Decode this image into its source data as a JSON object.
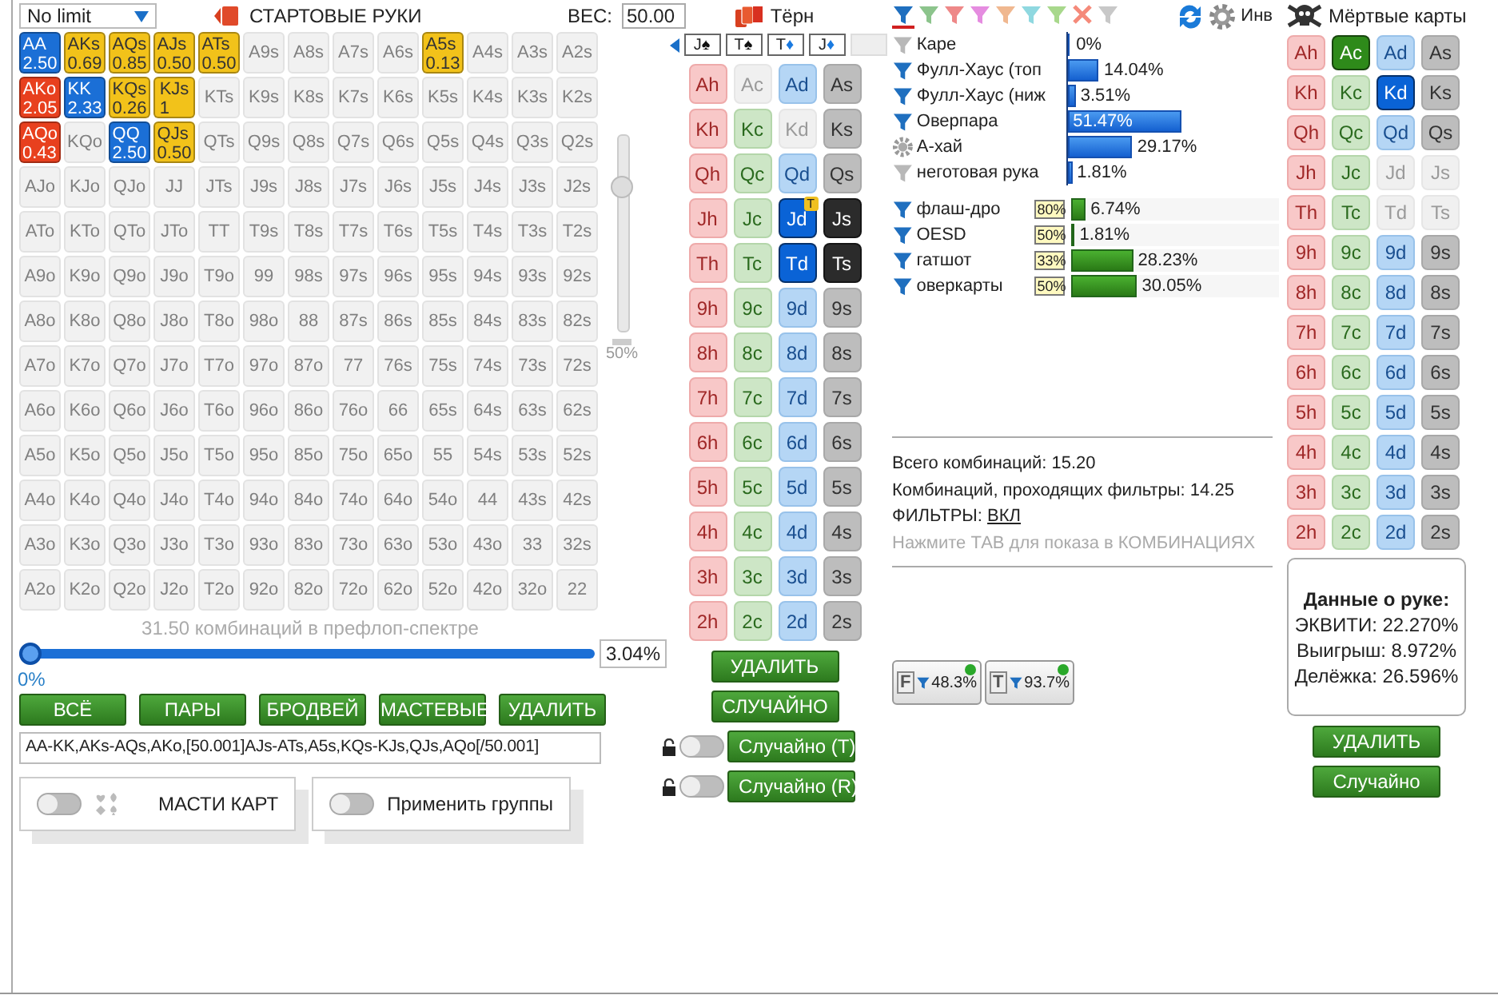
{
  "range_panel": {
    "game_select": {
      "value": "No limit"
    },
    "title": "СТАРТОВЫЕ РУКИ",
    "weight": {
      "label": "ВЕС:",
      "value": "50.00"
    },
    "grid": [
      [
        {
          "hand": "AA",
          "weight": "2.50",
          "color": "#1b6fd6"
        },
        {
          "hand": "AKs",
          "weight": "0.69",
          "color": "#f2c21a"
        },
        {
          "hand": "AQs",
          "weight": "0.85",
          "color": "#f2c21a"
        },
        {
          "hand": "AJs",
          "weight": "0.50",
          "color": "#f2c21a"
        },
        {
          "hand": "ATs",
          "weight": "0.50",
          "color": "#f2c21a"
        },
        {
          "hand": "A9s"
        },
        {
          "hand": "A8s"
        },
        {
          "hand": "A7s"
        },
        {
          "hand": "A6s"
        },
        {
          "hand": "A5s",
          "weight": "0.13",
          "color": "#f2c21a"
        },
        {
          "hand": "A4s"
        },
        {
          "hand": "A3s"
        },
        {
          "hand": "A2s"
        }
      ],
      [
        {
          "hand": "AKo",
          "weight": "2.05",
          "color": "#e8401e"
        },
        {
          "hand": "KK",
          "weight": "2.33",
          "color": "#1b6fd6"
        },
        {
          "hand": "KQs",
          "weight": "0.26",
          "color": "#f2c21a"
        },
        {
          "hand": "KJs",
          "weight": "1",
          "color": "#f2c21a"
        },
        {
          "hand": "KTs"
        },
        {
          "hand": "K9s"
        },
        {
          "hand": "K8s"
        },
        {
          "hand": "K7s"
        },
        {
          "hand": "K6s"
        },
        {
          "hand": "K5s"
        },
        {
          "hand": "K4s"
        },
        {
          "hand": "K3s"
        },
        {
          "hand": "K2s"
        }
      ],
      [
        {
          "hand": "AQo",
          "weight": "0.43",
          "color": "#e8401e"
        },
        {
          "hand": "KQo"
        },
        {
          "hand": "QQ",
          "weight": "2.50",
          "color": "#1b6fd6"
        },
        {
          "hand": "QJs",
          "weight": "0.50",
          "color": "#f2c21a"
        },
        {
          "hand": "QTs"
        },
        {
          "hand": "Q9s"
        },
        {
          "hand": "Q8s"
        },
        {
          "hand": "Q7s"
        },
        {
          "hand": "Q6s"
        },
        {
          "hand": "Q5s"
        },
        {
          "hand": "Q4s"
        },
        {
          "hand": "Q3s"
        },
        {
          "hand": "Q2s"
        }
      ],
      [
        {
          "hand": "AJo"
        },
        {
          "hand": "KJo"
        },
        {
          "hand": "QJo"
        },
        {
          "hand": "JJ"
        },
        {
          "hand": "JTs"
        },
        {
          "hand": "J9s"
        },
        {
          "hand": "J8s"
        },
        {
          "hand": "J7s"
        },
        {
          "hand": "J6s"
        },
        {
          "hand": "J5s"
        },
        {
          "hand": "J4s"
        },
        {
          "hand": "J3s"
        },
        {
          "hand": "J2s"
        }
      ],
      [
        {
          "hand": "ATo"
        },
        {
          "hand": "KTo"
        },
        {
          "hand": "QTo"
        },
        {
          "hand": "JTo"
        },
        {
          "hand": "TT"
        },
        {
          "hand": "T9s"
        },
        {
          "hand": "T8s"
        },
        {
          "hand": "T7s"
        },
        {
          "hand": "T6s"
        },
        {
          "hand": "T5s"
        },
        {
          "hand": "T4s"
        },
        {
          "hand": "T3s"
        },
        {
          "hand": "T2s"
        }
      ],
      [
        {
          "hand": "A9o"
        },
        {
          "hand": "K9o"
        },
        {
          "hand": "Q9o"
        },
        {
          "hand": "J9o"
        },
        {
          "hand": "T9o"
        },
        {
          "hand": "99"
        },
        {
          "hand": "98s"
        },
        {
          "hand": "97s"
        },
        {
          "hand": "96s"
        },
        {
          "hand": "95s"
        },
        {
          "hand": "94s"
        },
        {
          "hand": "93s"
        },
        {
          "hand": "92s"
        }
      ],
      [
        {
          "hand": "A8o"
        },
        {
          "hand": "K8o"
        },
        {
          "hand": "Q8o"
        },
        {
          "hand": "J8o"
        },
        {
          "hand": "T8o"
        },
        {
          "hand": "98o"
        },
        {
          "hand": "88"
        },
        {
          "hand": "87s"
        },
        {
          "hand": "86s"
        },
        {
          "hand": "85s"
        },
        {
          "hand": "84s"
        },
        {
          "hand": "83s"
        },
        {
          "hand": "82s"
        }
      ],
      [
        {
          "hand": "A7o"
        },
        {
          "hand": "K7o"
        },
        {
          "hand": "Q7o"
        },
        {
          "hand": "J7o"
        },
        {
          "hand": "T7o"
        },
        {
          "hand": "97o"
        },
        {
          "hand": "87o"
        },
        {
          "hand": "77"
        },
        {
          "hand": "76s"
        },
        {
          "hand": "75s"
        },
        {
          "hand": "74s"
        },
        {
          "hand": "73s"
        },
        {
          "hand": "72s"
        }
      ],
      [
        {
          "hand": "A6o"
        },
        {
          "hand": "K6o"
        },
        {
          "hand": "Q6o"
        },
        {
          "hand": "J6o"
        },
        {
          "hand": "T6o"
        },
        {
          "hand": "96o"
        },
        {
          "hand": "86o"
        },
        {
          "hand": "76o"
        },
        {
          "hand": "66"
        },
        {
          "hand": "65s"
        },
        {
          "hand": "64s"
        },
        {
          "hand": "63s"
        },
        {
          "hand": "62s"
        }
      ],
      [
        {
          "hand": "A5o"
        },
        {
          "hand": "K5o"
        },
        {
          "hand": "Q5o"
        },
        {
          "hand": "J5o"
        },
        {
          "hand": "T5o"
        },
        {
          "hand": "95o"
        },
        {
          "hand": "85o"
        },
        {
          "hand": "75o"
        },
        {
          "hand": "65o"
        },
        {
          "hand": "55"
        },
        {
          "hand": "54s"
        },
        {
          "hand": "53s"
        },
        {
          "hand": "52s"
        }
      ],
      [
        {
          "hand": "A4o"
        },
        {
          "hand": "K4o"
        },
        {
          "hand": "Q4o"
        },
        {
          "hand": "J4o"
        },
        {
          "hand": "T4o"
        },
        {
          "hand": "94o"
        },
        {
          "hand": "84o"
        },
        {
          "hand": "74o"
        },
        {
          "hand": "64o"
        },
        {
          "hand": "54o"
        },
        {
          "hand": "44"
        },
        {
          "hand": "43s"
        },
        {
          "hand": "42s"
        }
      ],
      [
        {
          "hand": "A3o"
        },
        {
          "hand": "K3o"
        },
        {
          "hand": "Q3o"
        },
        {
          "hand": "J3o"
        },
        {
          "hand": "T3o"
        },
        {
          "hand": "93o"
        },
        {
          "hand": "83o"
        },
        {
          "hand": "73o"
        },
        {
          "hand": "63o"
        },
        {
          "hand": "53o"
        },
        {
          "hand": "43o"
        },
        {
          "hand": "33"
        },
        {
          "hand": "32s"
        }
      ],
      [
        {
          "hand": "A2o"
        },
        {
          "hand": "K2o"
        },
        {
          "hand": "Q2o"
        },
        {
          "hand": "J2o"
        },
        {
          "hand": "T2o"
        },
        {
          "hand": "92o"
        },
        {
          "hand": "82o"
        },
        {
          "hand": "72o"
        },
        {
          "hand": "62o"
        },
        {
          "hand": "52o"
        },
        {
          "hand": "42o"
        },
        {
          "hand": "32o"
        },
        {
          "hand": "22"
        }
      ]
    ],
    "weight_slider": {
      "level": 0.76,
      "reading": "50%"
    },
    "combos_caption": "31.50 комбинаций в префлоп-спектре",
    "range_slider": {
      "level": 0,
      "min_label": "0%",
      "value": "3.04%"
    },
    "buttons": [
      "ВСЁ",
      "ПАРЫ",
      "БРОДВЕЙ",
      "МАСТЕВЫЕ",
      "УДАЛИТЬ"
    ],
    "range_text": "AA-KK,AKs-AQs,AKo,[50.001]AJs-ATs,A5s,KQs-KJs,QJs,AQo[/50.001]",
    "options": [
      {
        "kind": "suits",
        "label": "МАСТИ КАРТ",
        "on": false
      },
      {
        "kind": "plain",
        "label": "Применить группы",
        "on": false
      }
    ]
  },
  "board_panel": {
    "title": "Тёрн",
    "board": [
      {
        "kind": "spades",
        "rank": "J",
        "suit": "♠"
      },
      {
        "kind": "spades",
        "rank": "T",
        "suit": "♠"
      },
      {
        "kind": "diamonds",
        "rank": "T",
        "suit": "♦"
      },
      {
        "kind": "diamonds",
        "rank": "J",
        "suit": "♦"
      },
      {
        "kind": "empty"
      }
    ],
    "columns": [
      {
        "kind": "hearts",
        "cards": [
          {
            "label": "Ah",
            "selected": false,
            "disabled": false
          },
          {
            "label": "Kh",
            "selected": false,
            "disabled": false
          },
          {
            "label": "Qh",
            "selected": false,
            "disabled": false
          },
          {
            "label": "Jh",
            "selected": false,
            "disabled": false
          },
          {
            "label": "Th",
            "selected": false,
            "disabled": false
          },
          {
            "label": "9h",
            "selected": false,
            "disabled": false
          },
          {
            "label": "8h",
            "selected": false,
            "disabled": false
          },
          {
            "label": "7h",
            "selected": false,
            "disabled": false
          },
          {
            "label": "6h",
            "selected": false,
            "disabled": false
          },
          {
            "label": "5h",
            "selected": false,
            "disabled": false
          },
          {
            "label": "4h",
            "selected": false,
            "disabled": false
          },
          {
            "label": "3h",
            "selected": false,
            "disabled": false
          },
          {
            "label": "2h",
            "selected": false,
            "disabled": false
          }
        ]
      },
      {
        "kind": "clubs",
        "cards": [
          {
            "label": "Ac",
            "selected": false,
            "disabled": true
          },
          {
            "label": "Kc",
            "selected": false,
            "disabled": false
          },
          {
            "label": "Qc",
            "selected": false,
            "disabled": false
          },
          {
            "label": "Jc",
            "selected": false,
            "disabled": false
          },
          {
            "label": "Tc",
            "selected": false,
            "disabled": false
          },
          {
            "label": "9c",
            "selected": false,
            "disabled": false
          },
          {
            "label": "8c",
            "selected": false,
            "disabled": false
          },
          {
            "label": "7c",
            "selected": false,
            "disabled": false
          },
          {
            "label": "6c",
            "selected": false,
            "disabled": false
          },
          {
            "label": "5c",
            "selected": false,
            "disabled": false
          },
          {
            "label": "4c",
            "selected": false,
            "disabled": false
          },
          {
            "label": "3c",
            "selected": false,
            "disabled": false
          },
          {
            "label": "2c",
            "selected": false,
            "disabled": false
          }
        ]
      },
      {
        "kind": "diamonds",
        "cards": [
          {
            "label": "Ad",
            "selected": false,
            "disabled": false
          },
          {
            "label": "Kd",
            "selected": false,
            "disabled": true
          },
          {
            "label": "Qd",
            "selected": false,
            "disabled": false
          },
          {
            "label": "Jd",
            "selected": true,
            "disabled": false,
            "badge": "T"
          },
          {
            "label": "Td",
            "selected": true,
            "disabled": false
          },
          {
            "label": "9d",
            "selected": false,
            "disabled": false
          },
          {
            "label": "8d",
            "selected": false,
            "disabled": false
          },
          {
            "label": "7d",
            "selected": false,
            "disabled": false
          },
          {
            "label": "6d",
            "selected": false,
            "disabled": false
          },
          {
            "label": "5d",
            "selected": false,
            "disabled": false
          },
          {
            "label": "4d",
            "selected": false,
            "disabled": false
          },
          {
            "label": "3d",
            "selected": false,
            "disabled": false
          },
          {
            "label": "2d",
            "selected": false,
            "disabled": false
          }
        ]
      },
      {
        "kind": "spades",
        "cards": [
          {
            "label": "As",
            "selected": false,
            "disabled": false
          },
          {
            "label": "Ks",
            "selected": false,
            "disabled": false
          },
          {
            "label": "Qs",
            "selected": false,
            "disabled": false
          },
          {
            "label": "Js",
            "selected": true,
            "disabled": false
          },
          {
            "label": "Ts",
            "selected": true,
            "disabled": false
          },
          {
            "label": "9s",
            "selected": false,
            "disabled": false
          },
          {
            "label": "8s",
            "selected": false,
            "disabled": false
          },
          {
            "label": "7s",
            "selected": false,
            "disabled": false
          },
          {
            "label": "6s",
            "selected": false,
            "disabled": false
          },
          {
            "label": "5s",
            "selected": false,
            "disabled": false
          },
          {
            "label": "4s",
            "selected": false,
            "disabled": false
          },
          {
            "label": "3s",
            "selected": false,
            "disabled": false
          },
          {
            "label": "2s",
            "selected": false,
            "disabled": false
          }
        ]
      }
    ],
    "buttons": [
      "УДАЛИТЬ",
      "СЛУЧАЙНО"
    ],
    "random_buttons": [
      {
        "label": "Случайно (T)",
        "on": false
      },
      {
        "label": "Случайно (R)",
        "on": false
      }
    ]
  },
  "stats_panel": {
    "filter_icons": [
      {
        "kind": "funnel",
        "color": "#1f6fbf",
        "selected": true
      },
      {
        "kind": "funnel",
        "color": "#8cc48c",
        "selected": false
      },
      {
        "kind": "funnel",
        "color": "#ee8888",
        "selected": false
      },
      {
        "kind": "funnel",
        "color": "#e58ce0",
        "selected": false
      },
      {
        "kind": "funnel",
        "color": "#f0b890",
        "selected": false
      },
      {
        "kind": "funnel",
        "color": "#8fd8e0",
        "selected": false
      },
      {
        "kind": "funnel",
        "color": "#a8d88c",
        "selected": false
      },
      {
        "kind": "clear",
        "color": "#f58a7a",
        "selected": false
      },
      {
        "kind": "funnel",
        "color": "#c8c8c8",
        "selected": false
      }
    ],
    "tools_label": "Инв",
    "made_hands": [
      {
        "kind": "off",
        "label": "Каре",
        "level": 0,
        "value": "0%"
      },
      {
        "kind": "on",
        "label": "Фулл-Хаус (топ",
        "level": 0.1404,
        "value": "14.04%"
      },
      {
        "kind": "on",
        "label": "Фулл-Хаус (ниж",
        "level": 0.0351,
        "value": "3.51%"
      },
      {
        "kind": "on",
        "label": "Оверпара",
        "level": 0.5147,
        "value": "51.47%"
      },
      {
        "kind": "gear",
        "label": "А-хай",
        "level": 0.2917,
        "value": "29.17%"
      },
      {
        "kind": "off",
        "label": "неготовая рука",
        "level": 0.0181,
        "value": "1.81%"
      }
    ],
    "draws": [
      {
        "kind": "on",
        "label": "флаш-дро",
        "badge": "80%",
        "level": 0.0674,
        "value": "6.74%"
      },
      {
        "kind": "on",
        "label": "OESD",
        "badge": "50%",
        "level": 0.0181,
        "value": "1.81%"
      },
      {
        "kind": "on",
        "label": "гатшот",
        "badge": "33%",
        "level": 0.2823,
        "value": "28.23%"
      },
      {
        "kind": "on",
        "label": "оверкарты",
        "badge": "50%",
        "level": 0.3005,
        "value": "30.05%"
      }
    ],
    "total": "Всего комбинаций: 15.20",
    "passing": "Комбинаций, проходящих фильтры: 14.25",
    "filters": {
      "label": "ФИЛЬТРЫ:",
      "link": "ВКЛ"
    },
    "hint": "Нажмите ТАВ для показа в КОМБИНАЦИЯХ",
    "filter_buttons": [
      {
        "letter": "F",
        "value": "48.3%"
      },
      {
        "letter": "T",
        "value": "93.7%"
      }
    ]
  },
  "dead_panel": {
    "title": "Мёртвые карты",
    "columns": [
      {
        "kind": "hearts",
        "cards": [
          {
            "label": "Ah",
            "selected": false,
            "disabled": false
          },
          {
            "label": "Kh",
            "selected": false,
            "disabled": false
          },
          {
            "label": "Qh",
            "selected": false,
            "disabled": false
          },
          {
            "label": "Jh",
            "selected": false,
            "disabled": false
          },
          {
            "label": "Th",
            "selected": false,
            "disabled": false
          },
          {
            "label": "9h",
            "selected": false,
            "disabled": false
          },
          {
            "label": "8h",
            "selected": false,
            "disabled": false
          },
          {
            "label": "7h",
            "selected": false,
            "disabled": false
          },
          {
            "label": "6h",
            "selected": false,
            "disabled": false
          },
          {
            "label": "5h",
            "selected": false,
            "disabled": false
          },
          {
            "label": "4h",
            "selected": false,
            "disabled": false
          },
          {
            "label": "3h",
            "selected": false,
            "disabled": false
          },
          {
            "label": "2h",
            "selected": false,
            "disabled": false
          }
        ]
      },
      {
        "kind": "clubs",
        "cards": [
          {
            "label": "Ac",
            "selected": true,
            "disabled": false
          },
          {
            "label": "Kc",
            "selected": false,
            "disabled": false
          },
          {
            "label": "Qc",
            "selected": false,
            "disabled": false
          },
          {
            "label": "Jc",
            "selected": false,
            "disabled": false
          },
          {
            "label": "Tc",
            "selected": false,
            "disabled": false
          },
          {
            "label": "9c",
            "selected": false,
            "disabled": false
          },
          {
            "label": "8c",
            "selected": false,
            "disabled": false
          },
          {
            "label": "7c",
            "selected": false,
            "disabled": false
          },
          {
            "label": "6c",
            "selected": false,
            "disabled": false
          },
          {
            "label": "5c",
            "selected": false,
            "disabled": false
          },
          {
            "label": "4c",
            "selected": false,
            "disabled": false
          },
          {
            "label": "3c",
            "selected": false,
            "disabled": false
          },
          {
            "label": "2c",
            "selected": false,
            "disabled": false
          }
        ]
      },
      {
        "kind": "diamonds",
        "cards": [
          {
            "label": "Ad",
            "selected": false,
            "disabled": false
          },
          {
            "label": "Kd",
            "selected": true,
            "disabled": false
          },
          {
            "label": "Qd",
            "selected": false,
            "disabled": false
          },
          {
            "label": "Jd",
            "selected": false,
            "disabled": true
          },
          {
            "label": "Td",
            "selected": false,
            "disabled": true
          },
          {
            "label": "9d",
            "selected": false,
            "disabled": false
          },
          {
            "label": "8d",
            "selected": false,
            "disabled": false
          },
          {
            "label": "7d",
            "selected": false,
            "disabled": false
          },
          {
            "label": "6d",
            "selected": false,
            "disabled": false
          },
          {
            "label": "5d",
            "selected": false,
            "disabled": false
          },
          {
            "label": "4d",
            "selected": false,
            "disabled": false
          },
          {
            "label": "3d",
            "selected": false,
            "disabled": false
          },
          {
            "label": "2d",
            "selected": false,
            "disabled": false
          }
        ]
      },
      {
        "kind": "spades",
        "cards": [
          {
            "label": "As",
            "selected": false,
            "disabled": false
          },
          {
            "label": "Ks",
            "selected": false,
            "disabled": false
          },
          {
            "label": "Qs",
            "selected": false,
            "disabled": false
          },
          {
            "label": "Js",
            "selected": false,
            "disabled": true
          },
          {
            "label": "Ts",
            "selected": false,
            "disabled": true
          },
          {
            "label": "9s",
            "selected": false,
            "disabled": false
          },
          {
            "label": "8s",
            "selected": false,
            "disabled": false
          },
          {
            "label": "7s",
            "selected": false,
            "disabled": false
          },
          {
            "label": "6s",
            "selected": false,
            "disabled": false
          },
          {
            "label": "5s",
            "selected": false,
            "disabled": false
          },
          {
            "label": "4s",
            "selected": false,
            "disabled": false
          },
          {
            "label": "3s",
            "selected": false,
            "disabled": false
          },
          {
            "label": "2s",
            "selected": false,
            "disabled": false
          }
        ]
      }
    ],
    "hand_info": {
      "title": "Данные о руке:",
      "lines": [
        "ЭКВИТИ: 22.270%",
        "Выигрыш: 8.972%",
        "Делёжка: 26.596%"
      ]
    },
    "buttons": [
      "УДАЛИТЬ",
      "Случайно"
    ]
  }
}
